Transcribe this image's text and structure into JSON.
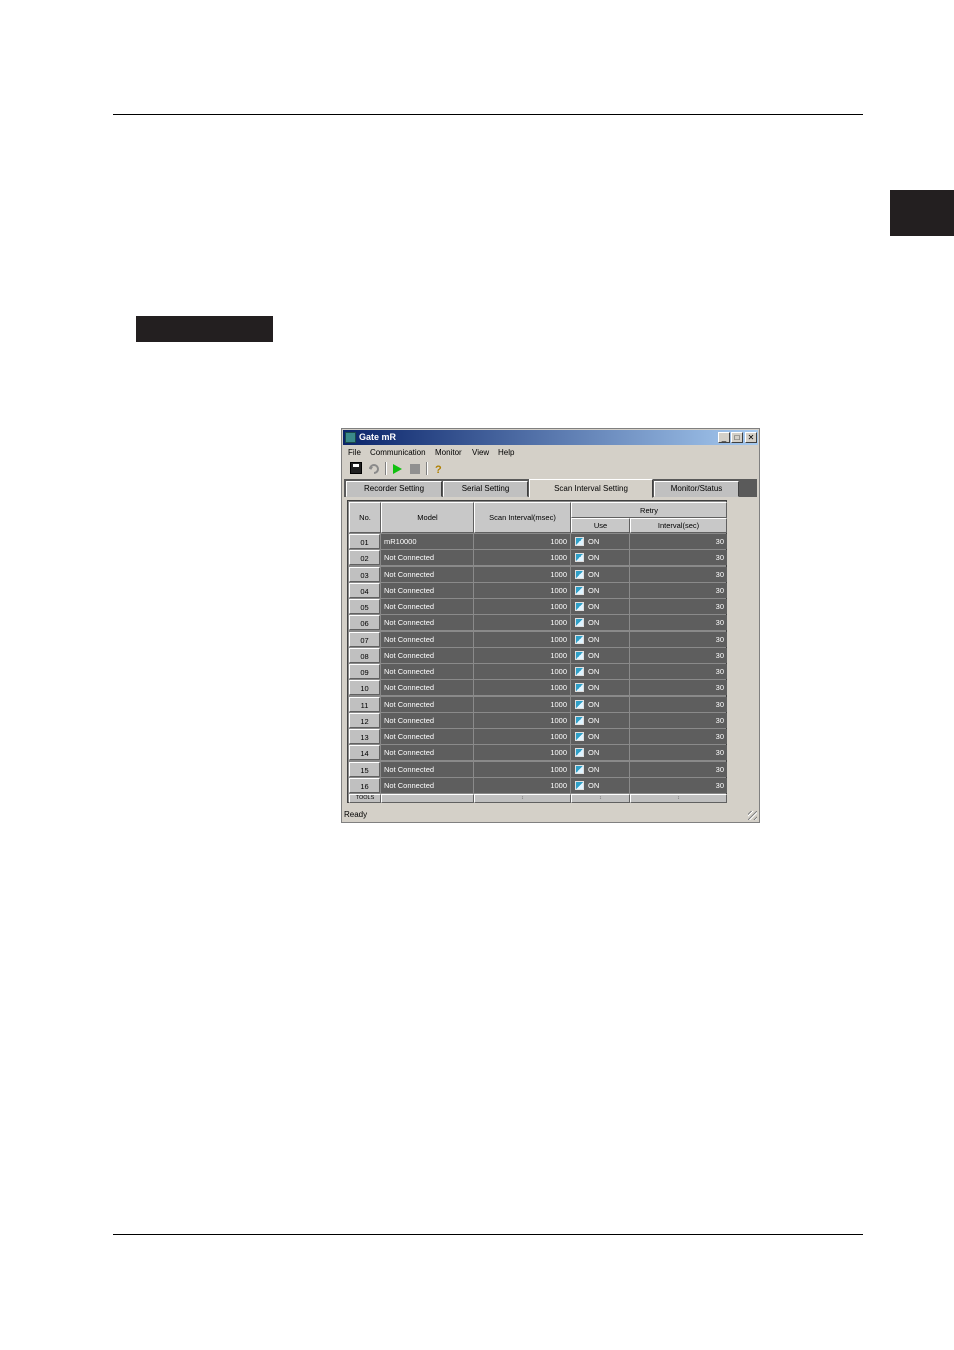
{
  "window": {
    "title": "Gate mR",
    "minimize_glyph": "_",
    "maximize_glyph": "□",
    "close_glyph": "✕"
  },
  "menu": [
    "File",
    "Communication",
    "Monitor",
    "View",
    "Help"
  ],
  "toolbar": {
    "icons": [
      "save-icon",
      "reload-icon",
      "play-icon",
      "stop-icon",
      "help-icon"
    ]
  },
  "tabs": [
    {
      "label": "Recorder Setting",
      "active": false
    },
    {
      "label": "Serial Setting",
      "active": false
    },
    {
      "label": "Scan Interval Setting",
      "active": true
    },
    {
      "label": "Monitor/Status",
      "active": false
    }
  ],
  "grid": {
    "headers": {
      "no": "No.",
      "model": "Model",
      "scan": "Scan Interval(msec)",
      "retry": "Retry",
      "use": "Use",
      "interval": "Interval(sec)"
    },
    "rows": [
      {
        "no": "01",
        "model": "mR10000",
        "scan": "1000",
        "use": "ON",
        "interval": "30"
      },
      {
        "no": "02",
        "model": "Not Connected",
        "scan": "1000",
        "use": "ON",
        "interval": "30"
      },
      {
        "no": "03",
        "model": "Not Connected",
        "scan": "1000",
        "use": "ON",
        "interval": "30"
      },
      {
        "no": "04",
        "model": "Not Connected",
        "scan": "1000",
        "use": "ON",
        "interval": "30"
      },
      {
        "no": "05",
        "model": "Not Connected",
        "scan": "1000",
        "use": "ON",
        "interval": "30"
      },
      {
        "no": "06",
        "model": "Not Connected",
        "scan": "1000",
        "use": "ON",
        "interval": "30"
      },
      {
        "no": "07",
        "model": "Not Connected",
        "scan": "1000",
        "use": "ON",
        "interval": "30"
      },
      {
        "no": "08",
        "model": "Not Connected",
        "scan": "1000",
        "use": "ON",
        "interval": "30"
      },
      {
        "no": "09",
        "model": "Not Connected",
        "scan": "1000",
        "use": "ON",
        "interval": "30"
      },
      {
        "no": "10",
        "model": "Not Connected",
        "scan": "1000",
        "use": "ON",
        "interval": "30"
      },
      {
        "no": "11",
        "model": "Not Connected",
        "scan": "1000",
        "use": "ON",
        "interval": "30"
      },
      {
        "no": "12",
        "model": "Not Connected",
        "scan": "1000",
        "use": "ON",
        "interval": "30"
      },
      {
        "no": "13",
        "model": "Not Connected",
        "scan": "1000",
        "use": "ON",
        "interval": "30"
      },
      {
        "no": "14",
        "model": "Not Connected",
        "scan": "1000",
        "use": "ON",
        "interval": "30"
      },
      {
        "no": "15",
        "model": "Not Connected",
        "scan": "1000",
        "use": "ON",
        "interval": "30"
      },
      {
        "no": "16",
        "model": "Not Connected",
        "scan": "1000",
        "use": "ON",
        "interval": "30"
      }
    ],
    "footer_label": "TOOLS",
    "footer_marks": [
      "↕",
      "↕",
      "↕"
    ]
  },
  "status": "Ready"
}
